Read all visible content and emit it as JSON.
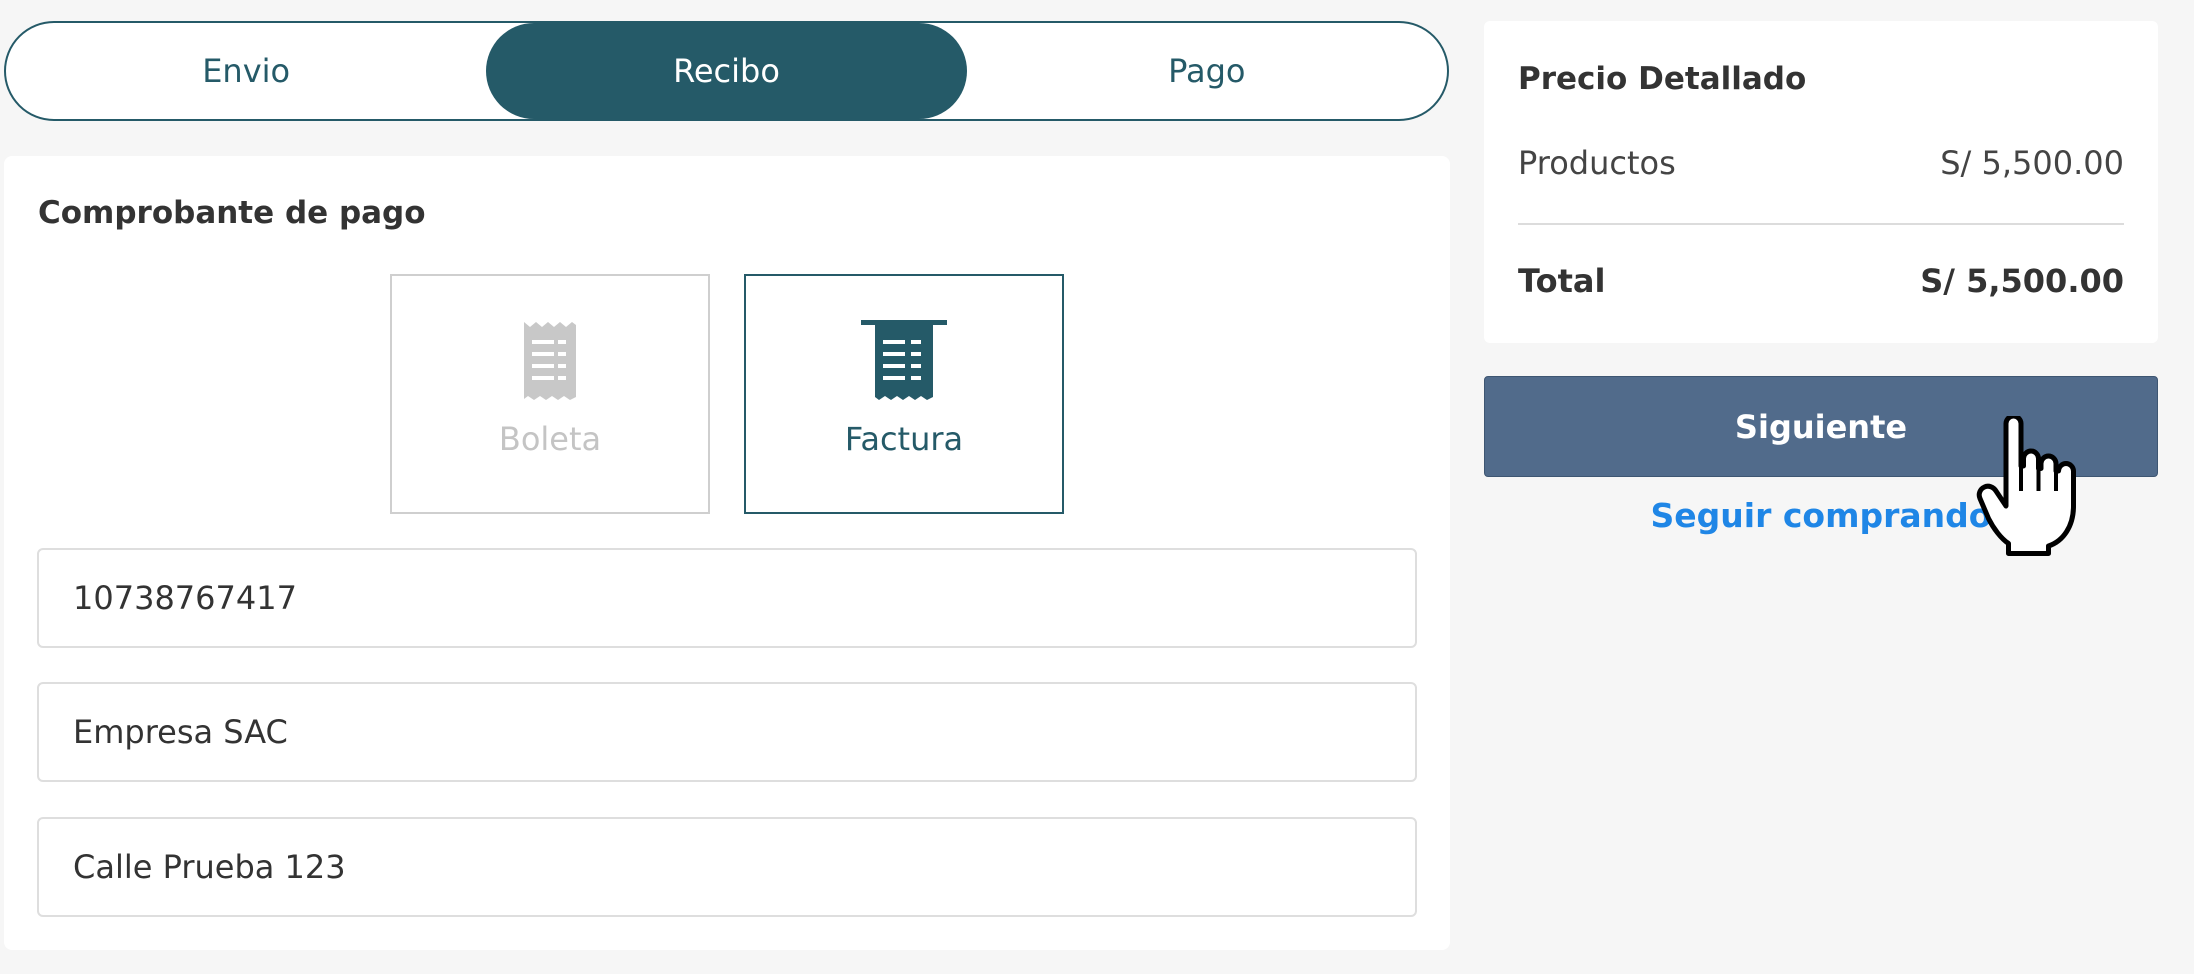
{
  "steps": {
    "items": [
      {
        "label": "Envio"
      },
      {
        "label": "Recibo",
        "active": true
      },
      {
        "label": "Pago"
      }
    ],
    "accent_color": "#255a68"
  },
  "receipt": {
    "title": "Comprobante de pago",
    "options": [
      {
        "label": "Boleta",
        "icon": "receipt-icon",
        "selected": false
      },
      {
        "label": "Factura",
        "icon": "invoice-icon",
        "selected": true
      }
    ],
    "fields": {
      "ruc_value": "10738767417",
      "company_value": "Empresa SAC",
      "address_value": "Calle Prueba 123"
    }
  },
  "summary": {
    "title": "Precio Detallado",
    "products_label": "Productos",
    "products_value": "S/ 5,500.00",
    "total_label": "Total",
    "total_value": "S/ 5,500.00"
  },
  "actions": {
    "next_label": "Siguiente",
    "next_color": "#516b8b",
    "continue_label": "Seguir comprando",
    "continue_color": "#1f86e6"
  },
  "cursor": {
    "icon": "hand-pointer-icon"
  }
}
